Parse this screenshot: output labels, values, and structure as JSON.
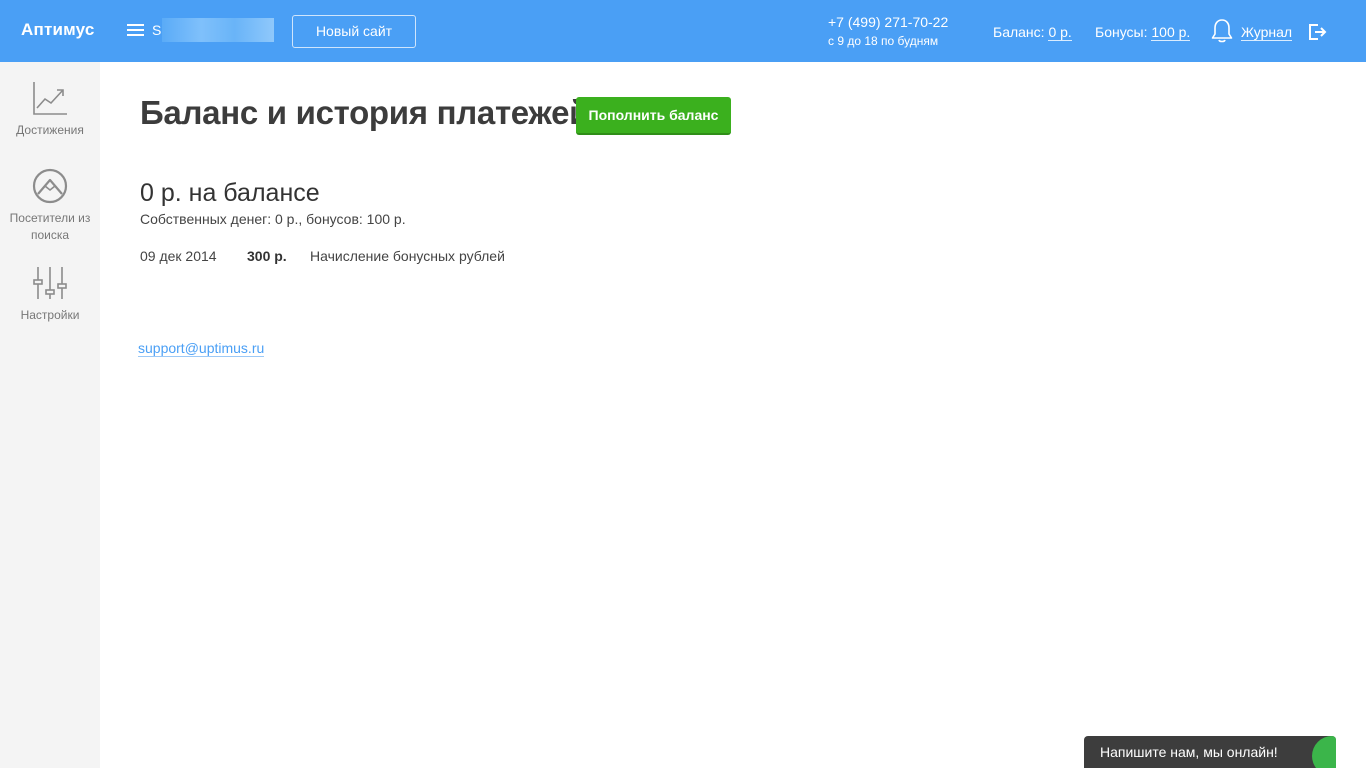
{
  "header": {
    "logo": "Аптимус",
    "site_name": "S",
    "new_site_button": "Новый сайт",
    "phone": "+7 (499) 271-70-22",
    "hours": "с 9 до 18 по будням",
    "balance_label": "Баланс:",
    "balance_value": "0 р.",
    "bonuses_label": "Бонусы:",
    "bonuses_value": "100 р.",
    "journal_link": "Журнал"
  },
  "sidebar": {
    "items": [
      {
        "label": "Достижения",
        "icon": "chart-trend-icon"
      },
      {
        "label": "Посетители из поиска",
        "icon": "mountain-circle-icon"
      },
      {
        "label": "Настройки",
        "icon": "sliders-icon"
      }
    ]
  },
  "main": {
    "title": "Баланс и история платежей",
    "topup_button": "Пополнить баланс",
    "balance_summary": "0 р. на балансе",
    "balance_detail": "Собственных денег: 0 р., бонусов: 100 р.",
    "transactions": [
      {
        "date": "09 дек 2014",
        "amount": "300 р.",
        "description": "Начисление бонусных рублей"
      }
    ],
    "support_email": "support@uptimus.ru"
  },
  "chat": {
    "label": "Напишите нам, мы онлайн!"
  },
  "colors": {
    "header_bg": "#4a9ff5",
    "accent_green": "#3bb01e",
    "sidebar_bg": "#f4f4f4",
    "link": "#4a9ff5"
  }
}
